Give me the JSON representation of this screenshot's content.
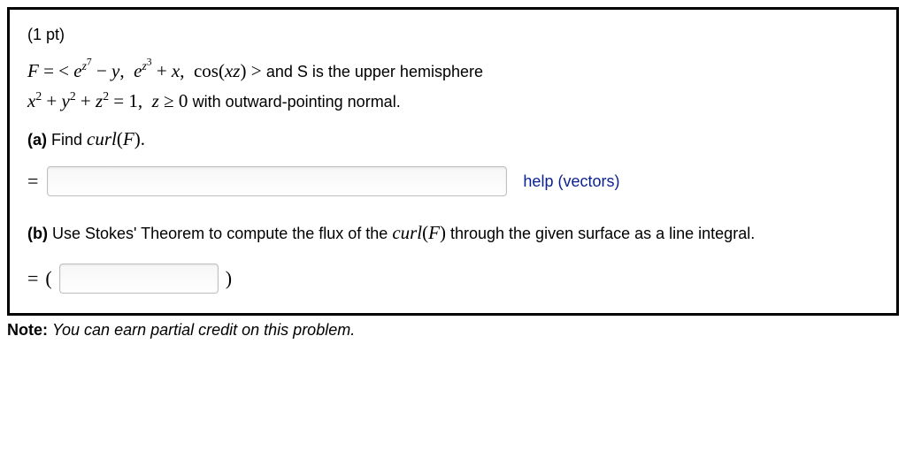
{
  "points": "(1 pt)",
  "statement": {
    "line1_math_html": "<span class='mathit'>F</span> = &lt; <span class='mathit'>e</span><sup class='sup-inner'><span class='mathit'>z</span><sup>7</sup></sup> − <span class='mathit'>y</span>, &nbsp;<span class='mathit'>e</span><sup class='sup-inner'><span class='mathit'>z</span><sup>3</sup></sup> + <span class='mathit'>x</span>, &nbsp;cos(<span class='mathit'>xz</span>) &gt; ",
    "line1_text": "and S is the upper hemisphere",
    "line2_math_html": "<span class='mathit'>x</span><sup>2</sup> + <span class='mathit'>y</span><sup>2</sup> + <span class='mathit'>z</span><sup>2</sup> = 1, &nbsp;<span class='mathit'>z</span> ≥ 0 ",
    "line2_text": "with outward-pointing normal."
  },
  "partA": {
    "label": "(a)",
    "text": " Find ",
    "curl_html": "<span class='mathit'>curl</span>(<span class='mathit'>F</span>).",
    "equals": "=",
    "help": "help (vectors)"
  },
  "partB": {
    "label": "(b)",
    "text1": " Use Stokes' Theorem to compute the flux of the ",
    "curl_html": "<span class='mathit'>curl</span>(<span class='mathit'>F</span>)",
    "text2": " through the given surface as a line integral.",
    "equals": "=",
    "lparen": "(",
    "rparen": ")"
  },
  "note": {
    "label": "Note:",
    "text": " You can earn partial credit on this problem."
  }
}
